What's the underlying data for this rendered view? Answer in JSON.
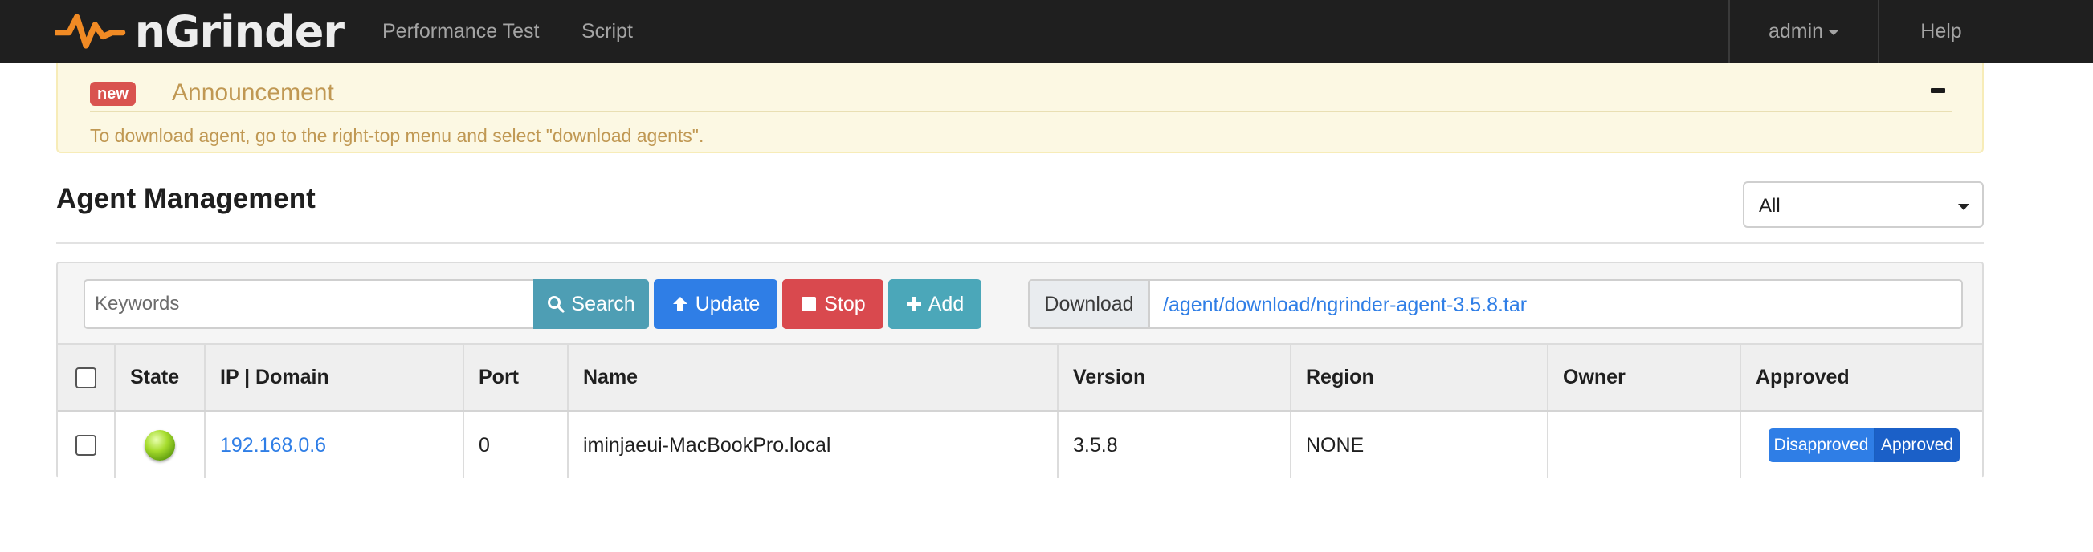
{
  "navbar": {
    "brand": "nGrinder",
    "links": [
      {
        "label": "Performance Test"
      },
      {
        "label": "Script"
      }
    ],
    "user_menu": "admin",
    "help": "Help"
  },
  "announcement": {
    "badge": "new",
    "title": "Announcement",
    "collapse_icon": "minus-icon",
    "message": "To download agent, go to the right-top menu and select \"download agents\"."
  },
  "page": {
    "title": "Agent Management",
    "filter_selected": "All"
  },
  "toolbar": {
    "keywords_placeholder": "Keywords",
    "search_label": "Search",
    "update_label": "Update",
    "stop_label": "Stop",
    "add_label": "Add",
    "download_label": "Download",
    "download_link": "/agent/download/ngrinder-agent-3.5.8.tar"
  },
  "table": {
    "columns": [
      "State",
      "IP | Domain",
      "Port",
      "Name",
      "Version",
      "Region",
      "Owner",
      "Approved"
    ],
    "rows": [
      {
        "state": "green",
        "ip": "192.168.0.6",
        "port": "0",
        "name": "iminjaeui-MacBookPro.local",
        "version": "3.5.8",
        "region": "NONE",
        "owner": "",
        "disapproved_label": "Disapproved",
        "approved_label": "Approved"
      }
    ]
  },
  "colors": {
    "navbar_bg": "#1f1f1f",
    "logo_orange": "#f08a24",
    "announcement_bg": "#fcf8e3",
    "announcement_text": "#c09853",
    "primary": "#2f7ee6",
    "info": "#4e9eb4",
    "danger": "#d9494e",
    "state_running": "#8cc63f"
  }
}
